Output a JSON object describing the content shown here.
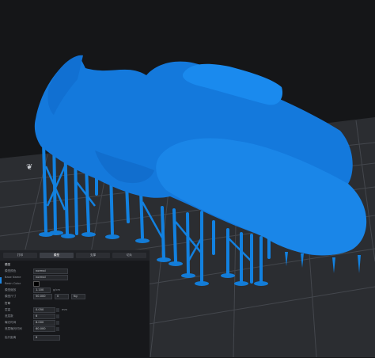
{
  "panel": {
    "tabs": [
      {
        "label": "打印"
      },
      {
        "label": "模型",
        "active": true
      },
      {
        "label": "支撑"
      },
      {
        "label": "切片"
      }
    ],
    "section_model": "模型",
    "rows_model": [
      {
        "label": "模型颜色",
        "value": "normal"
      },
      {
        "label": "Base Name",
        "value": "normal"
      },
      {
        "label": "Resin Color",
        "value": ""
      }
    ],
    "scale_label": "模型缩放",
    "scale_value": "1.100",
    "scale_unit": "g/cm",
    "size_label": "模型尺寸",
    "size_values": [
      "50.000",
      "0",
      "Kg"
    ],
    "section_print": "打印",
    "print_rows": [
      {
        "label": "层高",
        "value": "0.050",
        "unit": "mm"
      },
      {
        "label": "底层数",
        "value": "6"
      },
      {
        "label": "曝光时间",
        "value": "8.000"
      },
      {
        "label": "底层曝光时间",
        "value": "60.000"
      }
    ],
    "extra_label": "抬升距离",
    "extra_value": "6"
  },
  "colors": {
    "model": "#1281e0",
    "grid": "#3b3d42",
    "background": "#151618",
    "accent": "#1e88e5"
  }
}
